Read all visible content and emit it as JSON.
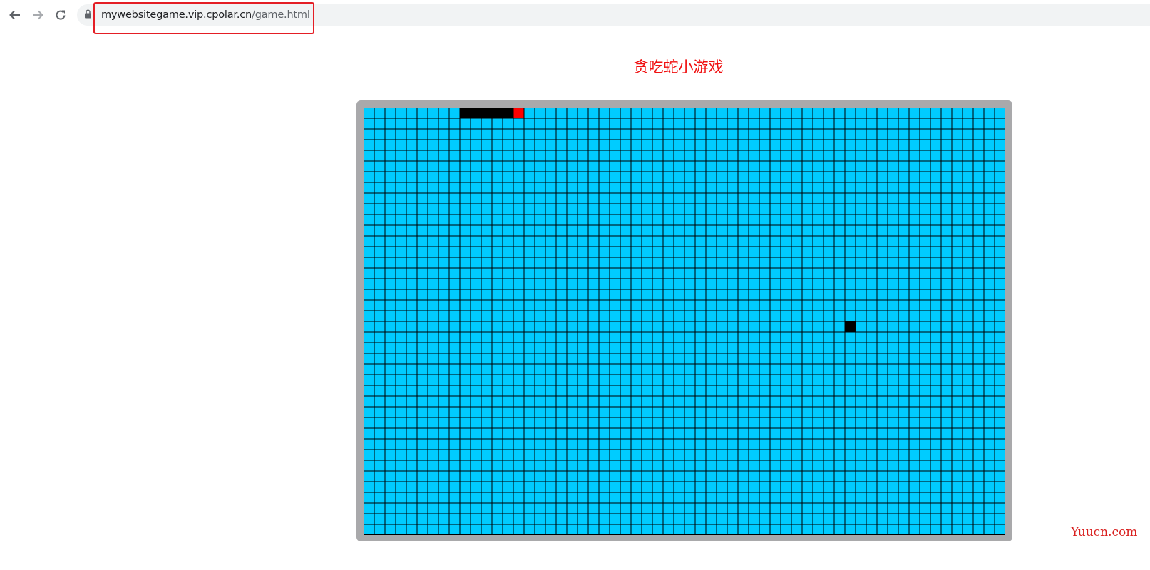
{
  "browser": {
    "url_host": "mywebsitegame.vip.cpolar.cn",
    "url_path": "/game.html",
    "icons": [
      "back-arrow-icon",
      "forward-arrow-icon",
      "reload-icon",
      "lock-icon"
    ]
  },
  "page": {
    "title": "贪吃蛇小游戏"
  },
  "game": {
    "columns": 60,
    "rows": 40,
    "cell_color": "#00ccff",
    "grid_line_color": "#000000",
    "snake_body": [
      [
        9,
        0
      ],
      [
        10,
        0
      ],
      [
        11,
        0
      ],
      [
        12,
        0
      ],
      [
        13,
        0
      ]
    ],
    "snake_head": [
      14,
      0
    ],
    "food": [
      45,
      20
    ],
    "snake_color": "#000000",
    "head_color": "#ff0000",
    "food_color": "#000000"
  },
  "watermark": "Yuucn.com",
  "colors": {
    "highlight": "#e41e25",
    "board_frame": "#a9a9ab",
    "title": "#f01010"
  }
}
